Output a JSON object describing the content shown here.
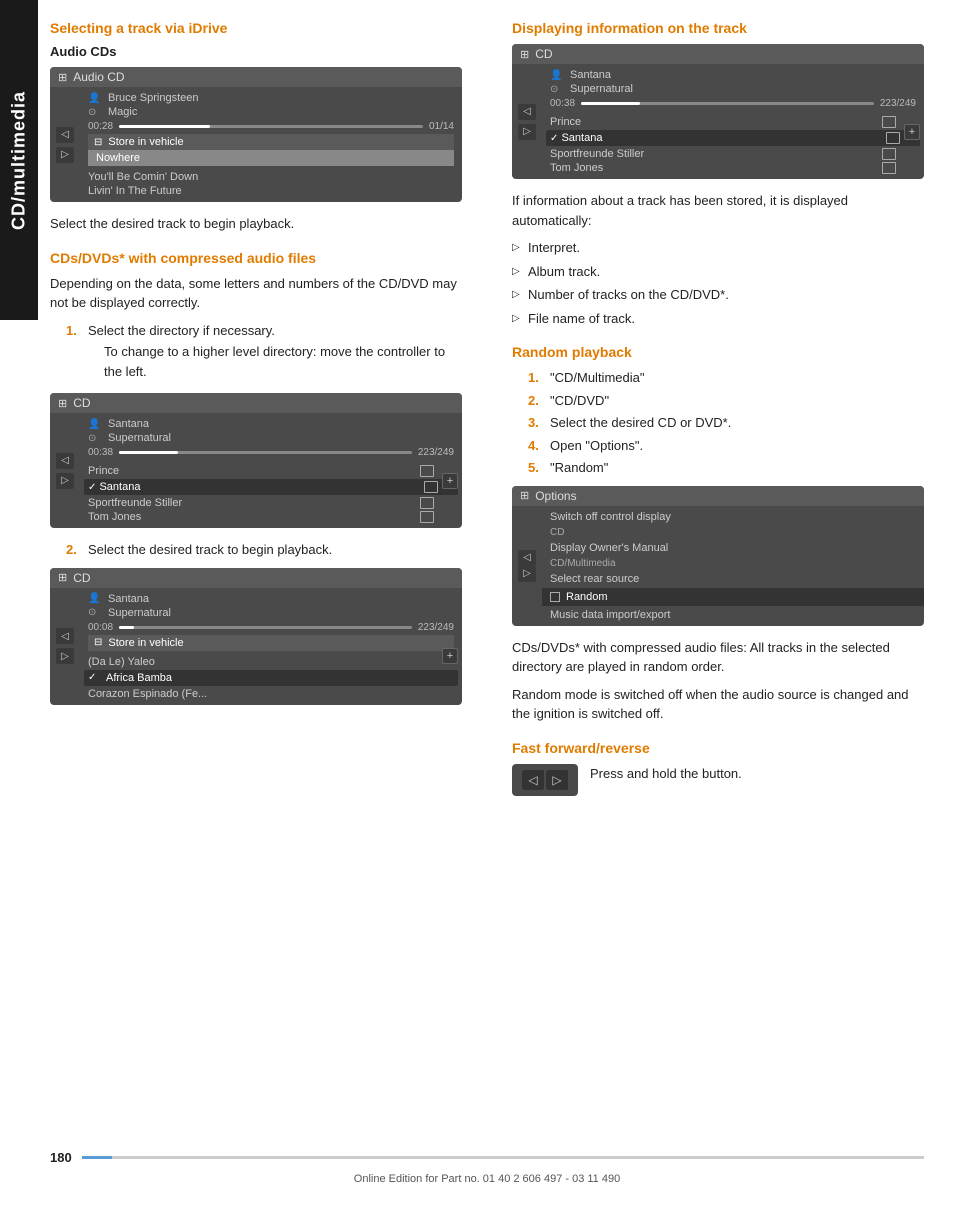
{
  "sidebar": {
    "label": "CD/multimedia"
  },
  "left_col": {
    "section1": {
      "title": "Selecting a track via iDrive",
      "subsection": "Audio CDs",
      "ui1": {
        "header": "Audio CD",
        "artist": "Bruce Springsteen",
        "album": "Magic",
        "time": "00:28",
        "total": "01/14",
        "store_label": "Store in vehicle",
        "nowhere": "Nowhere",
        "track1": "You'll Be Comin' Down",
        "track2": "Livin' In The Future"
      },
      "body_text": "Select the desired track to begin playback.",
      "subsection2": "CDs/DVDs* with compressed audio files",
      "compressed_text": "Depending on the data, some letters and numbers of the CD/DVD may not be displayed correctly.",
      "steps": [
        {
          "number": "1.",
          "text": "Select the directory if necessary.",
          "indent": "To change to a higher level directory: move the controller to the left."
        },
        {
          "number": "2.",
          "text": "Select the desired track to begin playback."
        }
      ],
      "ui2": {
        "header": "CD",
        "artist": "Santana",
        "album": "Supernatural",
        "time": "00:38",
        "total": "223/249",
        "track1": "Prince",
        "track2": "Santana",
        "track3": "Sportfreunde Stiller",
        "track4": "Tom Jones"
      },
      "ui3": {
        "header": "CD",
        "artist": "Santana",
        "album": "Supernatural",
        "time": "00:08",
        "total": "223/249",
        "store_label": "Store in vehicle",
        "track1": "(Da Le) Yaleo",
        "track2": "Africa Bamba",
        "track3": "Corazon Espinado (Fe..."
      }
    }
  },
  "right_col": {
    "section1": {
      "title": "Displaying information on the track",
      "ui": {
        "header": "CD",
        "artist": "Santana",
        "album": "Supernatural",
        "time": "00:38",
        "total": "223/249",
        "track1": "Prince",
        "track2": "Santana",
        "track3": "Sportfreunde Stiller",
        "track4": "Tom Jones"
      },
      "body_text": "If information about a track has been stored, it is displayed automatically:",
      "list": [
        "Interpret.",
        "Album track.",
        "Number of tracks on the CD/DVD*.",
        "File name of track."
      ]
    },
    "section2": {
      "title": "Random playback",
      "steps": [
        {
          "number": "1.",
          "text": "\"CD/Multimedia\""
        },
        {
          "number": "2.",
          "text": "\"CD/DVD\""
        },
        {
          "number": "3.",
          "text": "Select the desired CD or DVD*."
        },
        {
          "number": "4.",
          "text": "Open \"Options\"."
        },
        {
          "number": "5.",
          "text": "\"Random\""
        }
      ],
      "options_ui": {
        "header": "Options",
        "item1": "Switch off control display",
        "item2": "CD",
        "item3": "Display Owner's Manual",
        "item4": "CD/Multimedia",
        "item5": "Select rear source",
        "item6": "Random",
        "item7": "Music data import/export"
      },
      "para1": "CDs/DVDs* with compressed audio files: All tracks in the selected directory are played in random order.",
      "para2": "Random mode is switched off when the audio source is changed and the ignition is switched off."
    },
    "section3": {
      "title": "Fast forward/reverse",
      "body_text": "Press and hold the button."
    }
  },
  "footer": {
    "page_number": "180",
    "footer_text": "Online Edition for Part no. 01 40 2 606 497 - 03 11 490"
  }
}
